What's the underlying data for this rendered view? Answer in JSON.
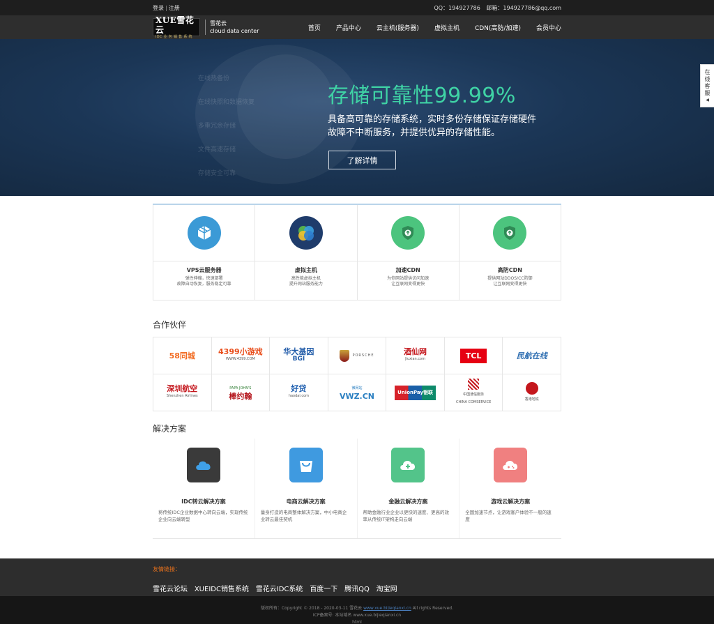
{
  "topbar": {
    "login": "登录",
    "separator": "|",
    "register": "注册",
    "qq": "QQ：194927786",
    "email": "邮箱：194927786@qq.com"
  },
  "header": {
    "logo_main": "XUE雪花云",
    "logo_sub": "IDC 业 务 销 售 系 统",
    "brand_cn": "雪花云",
    "brand_en": "cloud data center",
    "nav": [
      "首页",
      "产品中心",
      "云主机(服务器)",
      "虚拟主机",
      "CDN(高防/加速)",
      "会员中心"
    ]
  },
  "banner": {
    "ghost_items": [
      "在线热备份",
      "在线快照和数据恢复",
      "多重冗余存储",
      "文件高速存储",
      "存储安全可靠"
    ],
    "headline": "存储可靠性99.99%",
    "text_line1": "具备高可靠的存储系统，实时多份存储保证存储硬件",
    "text_line2": "故障不中断服务，并提供优异的存储性能。",
    "button": "了解详情"
  },
  "side_service": {
    "label": "在线客服",
    "arrow": "◀"
  },
  "services": [
    {
      "title": "VPS云服务器",
      "desc1": "弹性伸缩，快速部署",
      "desc2": "故障自动恢复，服务稳定可靠",
      "color": "#3b9ad6"
    },
    {
      "title": "虚拟主机",
      "desc1": "高性能虚拟主机",
      "desc2": "提升网站服务能力",
      "color": "#1f3c6b"
    },
    {
      "title": "加速CDN",
      "desc1": "为你网站提供访问加速",
      "desc2": "让互联网变得更快",
      "color": "#4cc47e"
    },
    {
      "title": "高防CDN",
      "desc1": "提供网站DDOS/CC防御",
      "desc2": "让互联网变得更快",
      "color": "#4cc47e"
    }
  ],
  "partners_title": "合作伙伴",
  "partners": [
    {
      "name": "58同城",
      "sub": "",
      "color": "#f26b21"
    },
    {
      "name": "4399小游戏",
      "sub": "WWW.4399.COM",
      "color": "#e94e1b"
    },
    {
      "name": "华大基因",
      "sub": "BGI",
      "color": "#1f5aa8"
    },
    {
      "name": "PORSCHE",
      "sub": "",
      "color": "#333333"
    },
    {
      "name": "酒仙网",
      "sub": "Jiuxian.com",
      "color": "#c4161c"
    },
    {
      "name": "TCL",
      "sub": "",
      "color": "#e60012"
    },
    {
      "name": "民航在线",
      "sub": "",
      "color": "#2b6cb0"
    },
    {
      "name": "深圳航空",
      "sub": "Shenzhen Airlines",
      "color": "#c4161c"
    },
    {
      "name": "棒约翰",
      "sub": "PAPA JOHN'S",
      "color": "#b4141b"
    },
    {
      "name": "好贷",
      "sub": "haodai.com",
      "color": "#2060b0"
    },
    {
      "name": "微网站",
      "sub": "VWZ.CN",
      "color": "#2a7fc1"
    },
    {
      "name": "UnionPay银联",
      "sub": "",
      "color": "#d6222a"
    },
    {
      "name": "中国通信服务",
      "sub": "CHINA COMSERVICE",
      "color": "#c4161c"
    },
    {
      "name": "香港地铁",
      "sub": "",
      "color": "#c4161c"
    }
  ],
  "solutions_title": "解决方案",
  "solutions": [
    {
      "title": "IDC转云解决方案",
      "desc": "将传统IDC企业数据中心转向云端，实现传统企业向云端转型",
      "color": "#3a3a3a"
    },
    {
      "title": "电商云解决方案",
      "desc": "量身打造的电商整体解决方案，中小电商企业转云最佳契机",
      "color": "#3f9ae0"
    },
    {
      "title": "金融云解决方案",
      "desc": "帮助金融行业企业以更快的速度、更高的效率从传统IT架构走向云端",
      "color": "#53c48a"
    },
    {
      "title": "游戏云解决方案",
      "desc": "全国加速节点，让游戏客户体验不一般的速度",
      "color": "#f08080"
    }
  ],
  "footer_links": {
    "label": "友情链接：",
    "links": [
      "雪花云论坛",
      "XUEIDC销售系统",
      "雪花云IDC系统",
      "百度一下",
      "腾讯QQ",
      "淘宝网"
    ]
  },
  "copyright": {
    "line1_prefix": "版权所有：Copyright © 2018 - 2020-03-11 雪花云",
    "line1_link": "www.xue.bijieqianxi.cn",
    "line1_suffix": "All rights Reserved.",
    "line2": "ICP备案号: 本站域名 www.xue.bijieqianxi.cn",
    "line3": "html"
  }
}
